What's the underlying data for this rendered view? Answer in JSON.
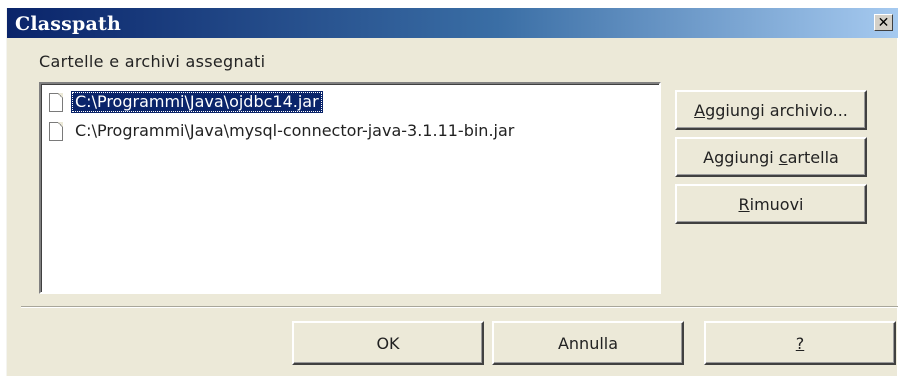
{
  "window": {
    "title": "Classpath",
    "close_label": "✕"
  },
  "section_label": "Cartelle e archivi assegnati",
  "list": {
    "items": [
      {
        "label": "C:\\Programmi\\Java\\ojdbc14.jar",
        "selected": true
      },
      {
        "label": "C:\\Programmi\\Java\\mysql-connector-java-3.1.11-bin.jar",
        "selected": false
      }
    ]
  },
  "side_buttons": {
    "add_archive_pre": "",
    "add_archive_mn": "A",
    "add_archive_post": "ggiungi archivio...",
    "add_folder_pre": "Aggiungi ",
    "add_folder_mn": "c",
    "add_folder_post": "artella",
    "remove_pre": "",
    "remove_mn": "R",
    "remove_post": "imuovi"
  },
  "footer_buttons": {
    "ok_label": "OK",
    "cancel_label": "Annulla",
    "help_label": "?"
  },
  "colors": {
    "title_bar_start": "#0a246a",
    "selection": "#0a246a",
    "dialog_bg": "#ece9d8"
  }
}
